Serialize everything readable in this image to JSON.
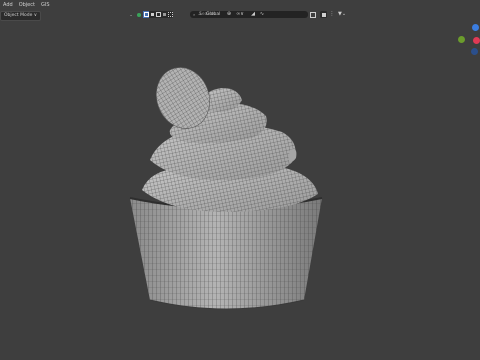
{
  "menu": {
    "items": [
      "Add",
      "Object",
      "GIS"
    ]
  },
  "mode": {
    "label": "Object Mode ∨"
  },
  "header": {
    "orientation_label": "Global",
    "search_placeholder": "Search"
  },
  "colors": {
    "background": "#3e3e3e",
    "accent_blue": "#4772b3",
    "gizmo_x": "#e03a55",
    "gizmo_y": "#6b9c2c",
    "gizmo_z": "#3b7de0"
  },
  "icons": [
    "select-box-icon",
    "transform-orientation-icon",
    "pivot-icon",
    "snap-icon",
    "proportional-icon",
    "view-layer-icon",
    "filter-icon"
  ]
}
